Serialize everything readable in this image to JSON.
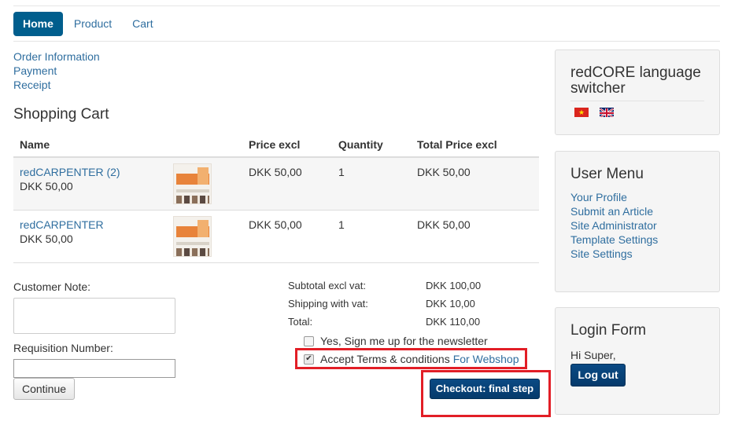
{
  "nav": {
    "items": [
      {
        "label": "Home",
        "active": true
      },
      {
        "label": "Product",
        "active": false
      },
      {
        "label": "Cart",
        "active": false
      }
    ]
  },
  "checkout_steps": [
    "Order Information",
    "Payment",
    "Receipt"
  ],
  "cart": {
    "title": "Shopping Cart",
    "headers": [
      "Name",
      "Price excl",
      "Quantity",
      "Total Price excl"
    ],
    "rows": [
      {
        "name": "redCARPENTER (2)",
        "sub_price": "DKK 50,00",
        "price": "DKK 50,00",
        "qty": "1",
        "total": "DKK 50,00"
      },
      {
        "name": "redCARPENTER",
        "sub_price": "DKK 50,00",
        "price": "DKK 50,00",
        "qty": "1",
        "total": "DKK 50,00"
      }
    ]
  },
  "form": {
    "customer_note_label": "Customer Note:",
    "customer_note_value": "",
    "requisition_label": "Requisition Number:",
    "requisition_value": "",
    "continue_label": "Continue"
  },
  "totals": {
    "subtotal_label": "Subtotal excl vat:",
    "subtotal_value": "DKK 100,00",
    "shipping_label": "Shipping with vat:",
    "shipping_value": "DKK 10,00",
    "total_label": "Total:",
    "total_value": "DKK 110,00"
  },
  "newsletter": {
    "label": "Yes, Sign me up for the newsletter",
    "checked": false
  },
  "terms": {
    "label": "Accept Terms & conditions",
    "link": "For Webshop",
    "checked": true
  },
  "checkout_button": "Checkout: final step",
  "highlight_color": "#e21e26",
  "sidebar": {
    "language": {
      "title": "redCORE language switcher",
      "flags": [
        "vietnam-flag-icon",
        "uk-flag-icon"
      ]
    },
    "user_menu": {
      "title": "User Menu",
      "items": [
        "Your Profile",
        "Submit an Article",
        "Site Administrator",
        "Template Settings",
        "Site Settings"
      ]
    },
    "login": {
      "title": "Login Form",
      "greeting": "Hi Super,",
      "logout_label": "Log out"
    }
  }
}
